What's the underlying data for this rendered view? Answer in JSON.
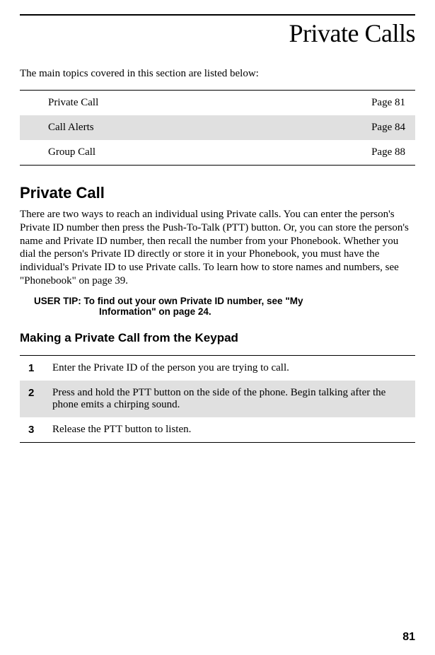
{
  "page_title": "Private Calls",
  "intro": "The main topics covered in this section are listed below:",
  "topics": [
    {
      "name": "Private Call",
      "page": "Page 81"
    },
    {
      "name": "Call Alerts",
      "page": "Page 84"
    },
    {
      "name": "Group Call",
      "page": "Page 88"
    }
  ],
  "section1": {
    "heading": "Private Call",
    "body": "There are two ways to reach an individual using Private calls. You can enter the person's Private ID number then press the Push-To-Talk (PTT) button. Or, you can store the person's name and Private ID number, then recall the number from your Phonebook. Whether you dial the person's Private ID directly or store it in your Phonebook, you must have the individual's Private ID to use Private calls. To learn how to store names and numbers, see \"Phonebook\" on page 39."
  },
  "user_tip": {
    "label": "USER TIP:",
    "line1": "To find out your own Private ID number, see \"My",
    "line2": "Information\" on page 24."
  },
  "section2": {
    "heading": "Making a Private Call from the Keypad",
    "steps": [
      {
        "num": "1",
        "text": "Enter the Private ID of the person you are trying to call."
      },
      {
        "num": "2",
        "text": "Press and hold the PTT button on the side of the phone. Begin talking after the phone emits a chirping sound."
      },
      {
        "num": "3",
        "text": "Release the PTT button to listen."
      }
    ]
  },
  "page_number": "81"
}
